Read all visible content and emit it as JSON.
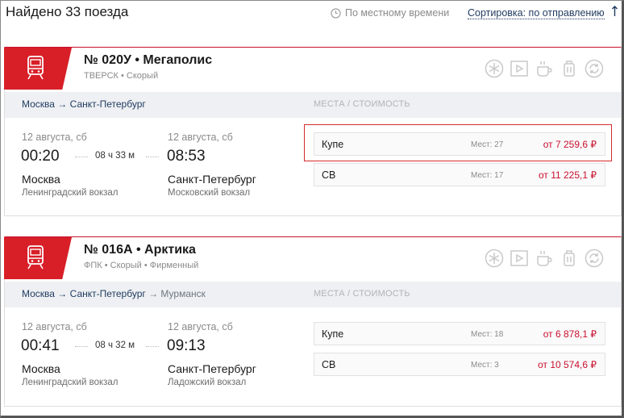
{
  "header": {
    "found_title": "Найдено 33 поезда",
    "time_label": "По местному времени",
    "sort_label": "Сортировка: по отправлению"
  },
  "icons": {
    "clock": "clock-icon",
    "sort_arrow": "arrow-up-icon",
    "train": "train-icon",
    "amenities": [
      "snowflake-icon",
      "video-icon",
      "coffee-icon",
      "luggage-icon",
      "refund-icon"
    ]
  },
  "colors": {
    "accent": "#d81f28",
    "price": "#c8102e",
    "link": "#1f3a5f",
    "route_bar": "#eef0f3"
  },
  "seats_header": "МЕСТА / СТОИМОСТЬ",
  "trains": [
    {
      "name": "№ 020У • Мегаполис",
      "sub": "ТВЕРСК • Скорый",
      "route": "Москва → Санкт-Петербург",
      "route_extra": "",
      "dep_date": "12 августа, сб",
      "arr_date": "12 августа, сб",
      "dep_time": "00:20",
      "arr_time": "08:53",
      "duration": "08 ч 33 м",
      "dep_city": "Москва",
      "arr_city": "Санкт-Петербург",
      "dep_station": "Ленинградский вокзал",
      "arr_station": "Московский вокзал",
      "fares": [
        {
          "class": "Купе",
          "seats": "Мест: 27",
          "price": "от 7 259,6 ₽"
        },
        {
          "class": "СВ",
          "seats": "Мест: 17",
          "price": "от 11 225,1 ₽"
        }
      ]
    },
    {
      "name": "№ 016А • Арктика",
      "sub": "ФПК • Скорый • Фирменный",
      "route": "Москва → Санкт-Петербург",
      "route_extra": " → Мурманск",
      "dep_date": "12 августа, сб",
      "arr_date": "12 августа, сб",
      "dep_time": "00:41",
      "arr_time": "09:13",
      "duration": "08 ч 32 м",
      "dep_city": "Москва",
      "arr_city": "Санкт-Петербург",
      "dep_station": "Ленинградский вокзал",
      "arr_station": "Ладожский вокзал",
      "fares": [
        {
          "class": "Купе",
          "seats": "Мест: 18",
          "price": "от 6 878,1 ₽"
        },
        {
          "class": "СВ",
          "seats": "Мест: 3",
          "price": "от 10 574,6 ₽"
        }
      ]
    }
  ]
}
